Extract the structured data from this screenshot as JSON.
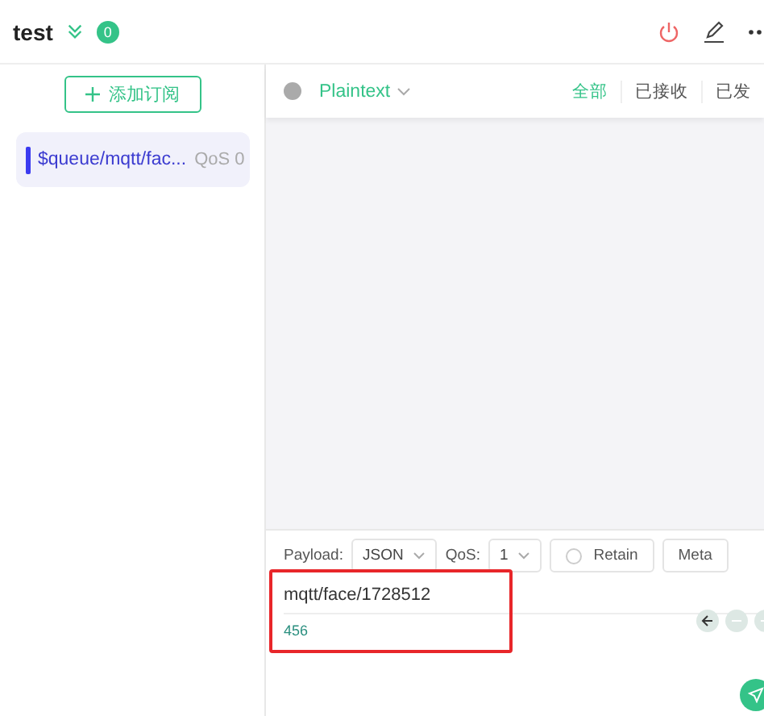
{
  "header": {
    "title": "test",
    "badge": "0"
  },
  "sidebar": {
    "add_button": "添加订阅",
    "subscriptions": [
      {
        "topic": "$queue/mqtt/fac...",
        "qos": "QoS 0",
        "color": "#3b3bf0",
        "selected": true
      }
    ]
  },
  "messages_bar": {
    "format": "Plaintext",
    "filters": [
      {
        "label": "全部",
        "selected": true
      },
      {
        "label": "已接收",
        "selected": false
      },
      {
        "label": "已发",
        "selected": false
      }
    ]
  },
  "publish": {
    "payload_label": "Payload:",
    "payload_type": "JSON",
    "qos_label": "QoS:",
    "qos": "1",
    "retain": {
      "label": "Retain",
      "checked": false
    },
    "meta_button": "Meta",
    "topic": "mqtt/face/1728512",
    "payload": "456"
  }
}
